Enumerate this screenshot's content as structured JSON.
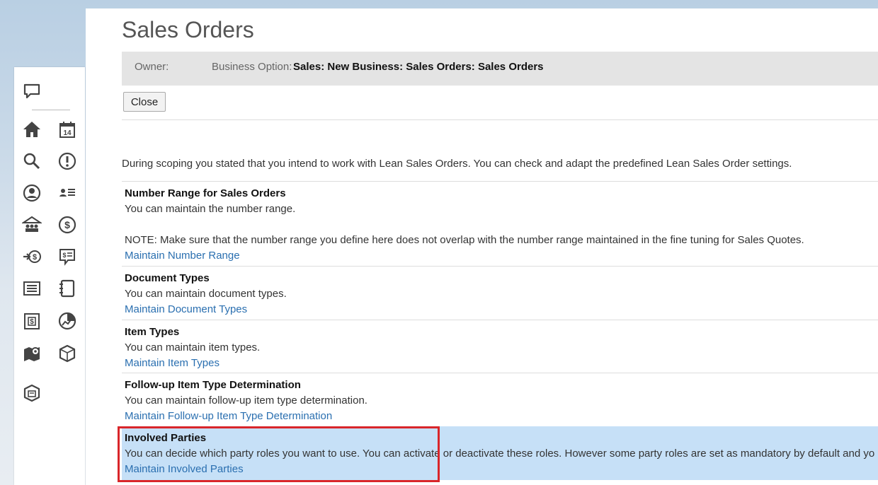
{
  "page": {
    "title": "Sales Orders",
    "owner_label": "Owner:",
    "business_option_label": "Business Option:",
    "business_option_value": "Sales: New Business: Sales Orders: Sales Orders",
    "close_label": "Close",
    "intro": "During scoping you stated that you intend to work with Lean Sales Orders. You can check and adapt the predefined Lean Sales Order settings."
  },
  "sections": [
    {
      "title": "Number Range for Sales Orders",
      "text": "You can maintain the number range.",
      "note": "NOTE: Make sure that the number range you define here does not overlap with the number range maintained in the fine tuning for Sales Quotes.",
      "link": "Maintain Number Range"
    },
    {
      "title": "Document Types",
      "text": "You can maintain document types.",
      "link": "Maintain Document Types"
    },
    {
      "title": "Item Types",
      "text": "You can maintain item types.",
      "link": "Maintain Item Types"
    },
    {
      "title": "Follow-up Item Type Determination",
      "text": "You can maintain follow-up item type determination.",
      "link": "Maintain Follow-up Item Type Determination"
    },
    {
      "title": "Involved Parties",
      "text": "You can decide which party roles you want to use. You can activate or deactivate these roles. However some party roles are set as mandatory by default and yo",
      "link": "Maintain Involved Parties"
    }
  ],
  "sidebar": {
    "icons": [
      "feedback-icon",
      "home-icon",
      "calendar-icon",
      "search-icon",
      "alert-icon",
      "account-icon",
      "contacts-list-icon",
      "accounts-building-icon",
      "dollar-circle-icon",
      "sales-arrow-icon",
      "quote-icon",
      "list-icon",
      "notebook-icon",
      "invoice-icon",
      "analytics-icon",
      "map-icon",
      "product-box-icon",
      "products-icon"
    ],
    "calendar_day": "14"
  },
  "colors": {
    "link": "#2a6fb0",
    "highlight_row": "#c6e0f7",
    "annotation_box": "#d9262a"
  }
}
